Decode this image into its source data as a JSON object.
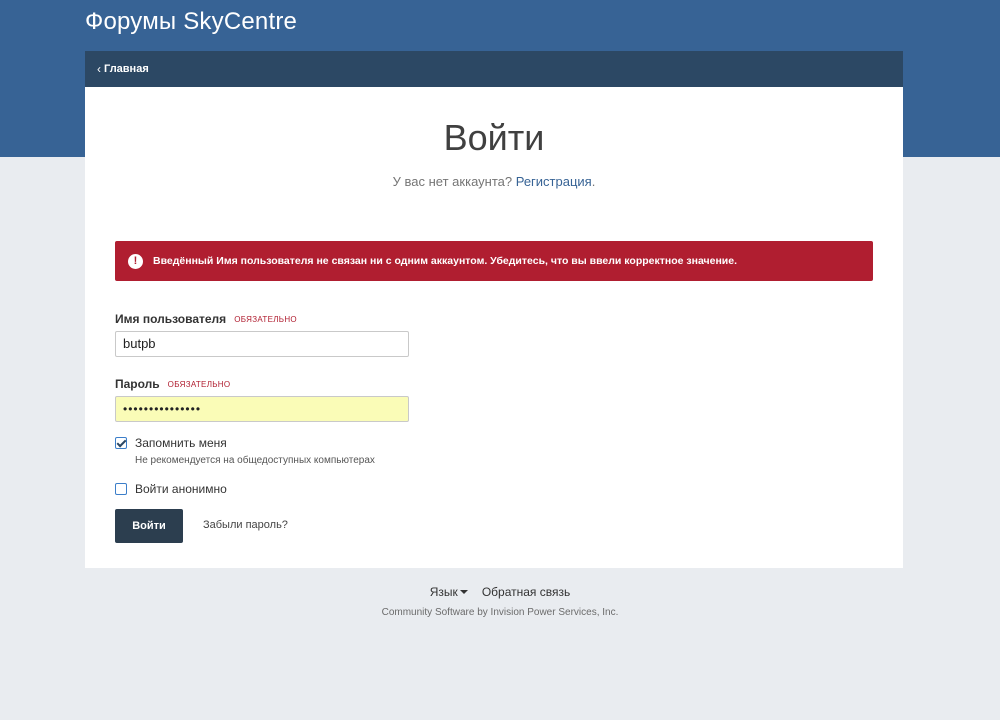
{
  "header": {
    "site_title": "Форумы SkyCentre"
  },
  "nav": {
    "home_label": "Главная",
    "home_icon": "chevron-left-icon"
  },
  "login": {
    "title": "Войти",
    "no_account_text": "У вас нет аккаунта? ",
    "register_link": "Регистрация",
    "register_suffix": ".",
    "error_icon": "exclamation-circle-icon",
    "error_message": "Введённый Имя пользователя не связан ни с одним аккаунтом. Убедитесь, что вы ввели корректное значение.",
    "username_label": "Имя пользователя",
    "username_required": "ОБЯЗАТЕЛЬНО",
    "username_value": "butpb",
    "password_label": "Пароль",
    "password_required": "ОБЯЗАТЕЛЬНО",
    "password_value": "•••••••••••••••",
    "remember_label": "Запомнить меня",
    "remember_hint": "Не рекомендуется на общедоступных компьютерах",
    "remember_checked": true,
    "anonymous_label": "Войти анонимно",
    "anonymous_checked": false,
    "submit_label": "Войти",
    "forgot_label": "Забыли пароль?"
  },
  "footer": {
    "language_label": "Язык",
    "feedback_label": "Обратная связь",
    "copyright": "Community Software by Invision Power Services, Inc."
  },
  "colors": {
    "header_bg": "#376395",
    "nav_bg": "#2c4864",
    "error_bg": "#b01e30",
    "button_bg": "#2c3e4f",
    "link": "#376395",
    "page_bg": "#e9ecf0"
  }
}
